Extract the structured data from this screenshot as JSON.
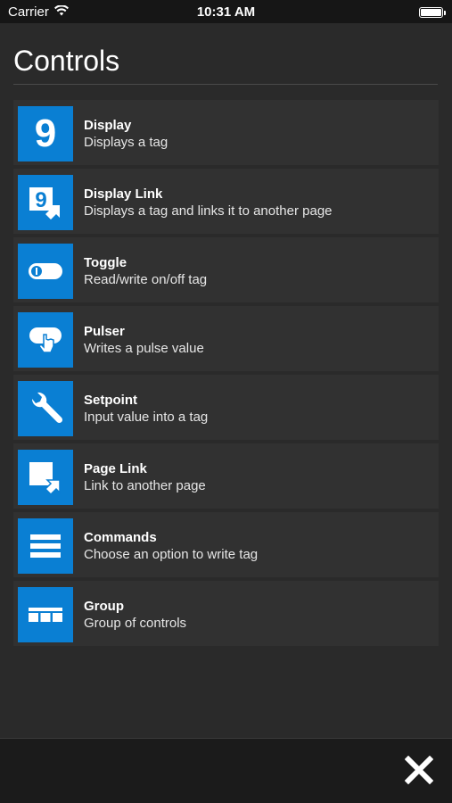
{
  "status_bar": {
    "carrier": "Carrier",
    "time": "10:31 AM",
    "wifi_icon": "wifi-icon",
    "battery_icon": "battery-icon"
  },
  "panel": {
    "title": "Controls"
  },
  "controls": [
    {
      "name": "Display",
      "description": "Displays a tag",
      "icon": "display-icon"
    },
    {
      "name": "Display Link",
      "description": "Displays a tag and links it to another page",
      "icon": "display-link-icon"
    },
    {
      "name": "Toggle",
      "description": "Read/write on/off tag",
      "icon": "toggle-icon"
    },
    {
      "name": "Pulser",
      "description": "Writes a pulse value",
      "icon": "pulser-icon"
    },
    {
      "name": "Setpoint",
      "description": "Input value into a tag",
      "icon": "wrench-icon"
    },
    {
      "name": "Page Link",
      "description": "Link to another page",
      "icon": "page-link-icon"
    },
    {
      "name": "Commands",
      "description": "Choose an option to write tag",
      "icon": "commands-icon"
    },
    {
      "name": "Group",
      "description": "Group of controls",
      "icon": "group-icon"
    }
  ],
  "icon_glyph_display": "9",
  "bottom_bar": {
    "close_icon": "close-icon"
  },
  "colors": {
    "accent": "#0a7fd3",
    "panel_background": "#2a2a2a",
    "item_background": "#313131",
    "screen_background": "#161616"
  }
}
